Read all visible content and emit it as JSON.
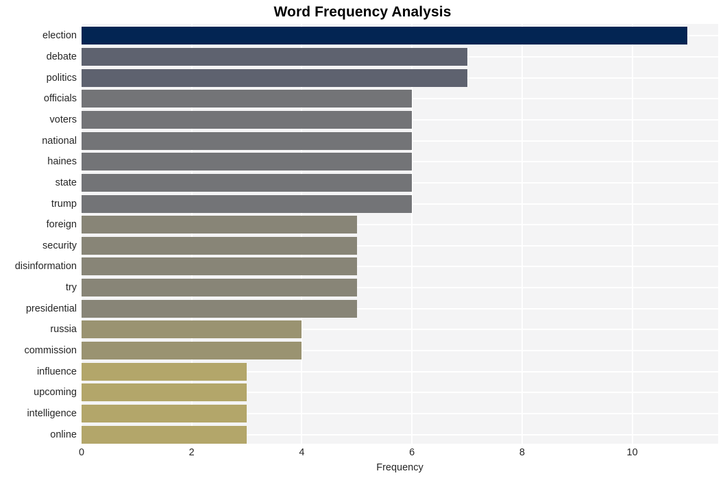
{
  "chart_data": {
    "type": "bar",
    "orientation": "horizontal",
    "title": "Word Frequency Analysis",
    "xlabel": "Frequency",
    "ylabel": "",
    "xlim": [
      0,
      11.56
    ],
    "xticks": [
      0,
      2,
      4,
      6,
      8,
      10
    ],
    "xtick_labels": [
      "0",
      "2",
      "4",
      "6",
      "8",
      "10"
    ],
    "grid": true,
    "legend": null,
    "categories": [
      "election",
      "debate",
      "politics",
      "officials",
      "voters",
      "national",
      "haines",
      "state",
      "trump",
      "foreign",
      "security",
      "disinformation",
      "try",
      "presidential",
      "russia",
      "commission",
      "influence",
      "upcoming",
      "intelligence",
      "online"
    ],
    "values": [
      11,
      7,
      7,
      6,
      6,
      6,
      6,
      6,
      6,
      5,
      5,
      5,
      5,
      5,
      4,
      4,
      3,
      3,
      3,
      3
    ],
    "bar_colors": [
      "#032553",
      "#5e626f",
      "#5e626f",
      "#737477",
      "#737477",
      "#737477",
      "#737477",
      "#737477",
      "#737477",
      "#888577",
      "#888577",
      "#888577",
      "#888577",
      "#888577",
      "#9a9371",
      "#9a9371",
      "#b3a66a",
      "#b3a66a",
      "#b3a66a",
      "#b3a66a"
    ],
    "plot_background": "#f4f4f5",
    "gridline_color": "#ffffff",
    "figure_background": "#ffffff",
    "text_color": "#262626"
  }
}
